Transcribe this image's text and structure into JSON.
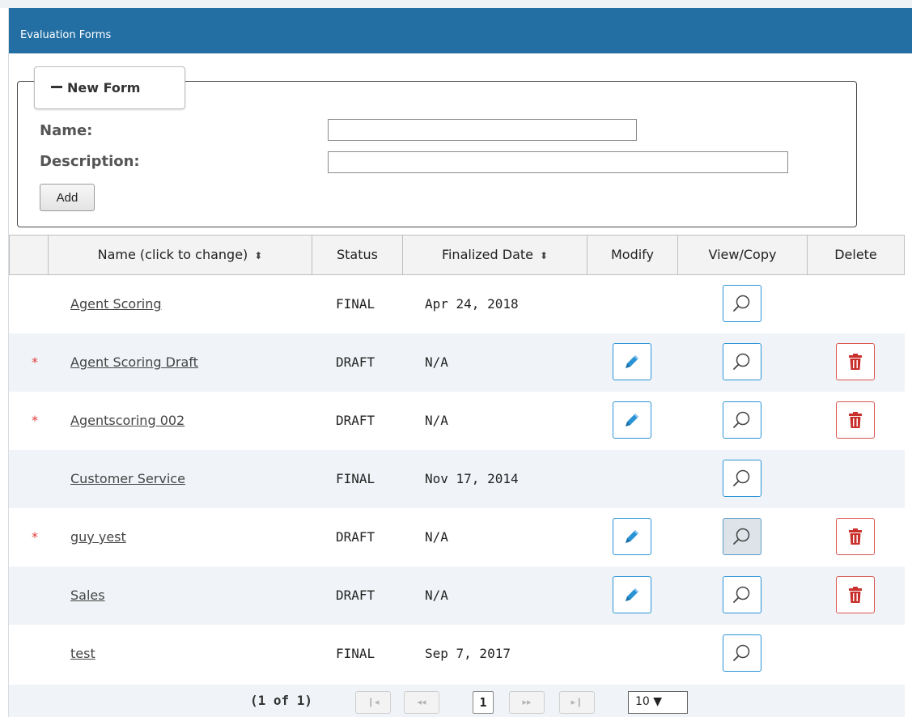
{
  "panel": {
    "title": "Evaluation Forms"
  },
  "new_form": {
    "legend": "New Form",
    "name_label": "Name:",
    "name_value": "",
    "description_label": "Description:",
    "description_value": "",
    "add_label": "Add"
  },
  "table": {
    "headers": {
      "name": "Name (click to change)",
      "status": "Status",
      "finalized_date": "Finalized Date",
      "modify": "Modify",
      "view_copy": "View/Copy",
      "delete": "Delete"
    },
    "rows": [
      {
        "marker": "",
        "name": "Agent Scoring",
        "status": "FINAL",
        "date": "Apr 24, 2018",
        "modify": false,
        "delete": false
      },
      {
        "marker": "*",
        "name": "Agent Scoring Draft",
        "status": "DRAFT",
        "date": "N/A",
        "modify": true,
        "delete": true
      },
      {
        "marker": "*",
        "name": "Agentscoring 002",
        "status": "DRAFT",
        "date": "N/A",
        "modify": true,
        "delete": true
      },
      {
        "marker": "",
        "name": "Customer Service",
        "status": "FINAL",
        "date": "Nov 17, 2014",
        "modify": false,
        "delete": false
      },
      {
        "marker": "*",
        "name": "guy yest",
        "status": "DRAFT",
        "date": "N/A",
        "modify": true,
        "delete": true,
        "view_active": true
      },
      {
        "marker": "",
        "name": "Sales",
        "status": "DRAFT",
        "date": "N/A",
        "modify": true,
        "delete": true
      },
      {
        "marker": "",
        "name": "test",
        "status": "FINAL",
        "date": "Sep 7, 2017",
        "modify": false,
        "delete": false
      }
    ]
  },
  "pager": {
    "summary": "(1 of 1)",
    "current_page": "1",
    "rows_per_page": "10 ▼",
    "first_icon": "first-page-icon",
    "prev_icon": "prev-page-icon",
    "next_icon": "next-page-icon",
    "last_icon": "last-page-icon"
  },
  "colors": {
    "header_bg": "#236fa4",
    "accent_blue": "#2a93d5",
    "delete_red": "#d9534f",
    "alt_row": "#f0f4f8"
  }
}
